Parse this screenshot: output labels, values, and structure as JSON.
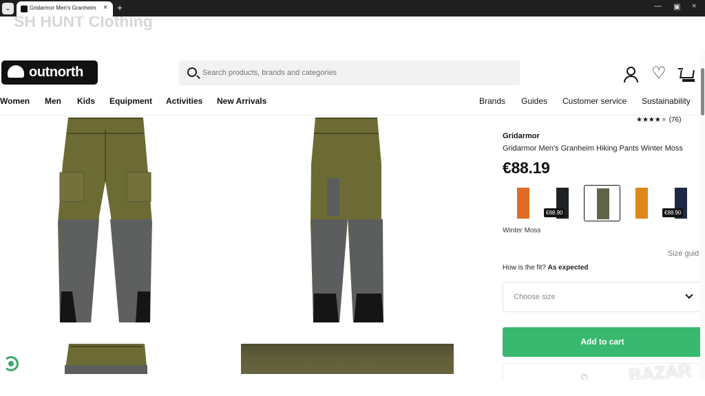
{
  "browser": {
    "tab_title": "Gridarmor Men's Granheim Hik"
  },
  "site": {
    "ghost_title": "SH HUNT Clothing",
    "logo": "outnorth",
    "search_placeholder": "Search products, brands and categories"
  },
  "nav": {
    "left": [
      "Women",
      "Men",
      "Kids",
      "Equipment",
      "Activities",
      "New Arrivals"
    ],
    "right": [
      "Brands",
      "Guides",
      "Customer service",
      "Sustainability"
    ]
  },
  "product": {
    "rating_stars": "★★★★",
    "rating_empty": "★",
    "rating_count": "(76)",
    "brand": "Gridarmor",
    "name": "Gridarmor Men's Granheim Hiking Pants Winter Moss",
    "price": "€88.19",
    "swatches": [
      {
        "color": "#e06b25",
        "price": ""
      },
      {
        "color": "#202326",
        "price": "€88.90"
      },
      {
        "color": "#5f6548",
        "price": ""
      },
      {
        "color": "#dc8718",
        "price": ""
      },
      {
        "color": "#1e2a45",
        "price": "€88.90"
      }
    ],
    "selected_color": "Winter Moss",
    "size_guide": "Size guid",
    "fit_question": "How is the fit?",
    "fit_answer": "As expected",
    "choose_size": "Choose size",
    "add_to_cart": "Add to cart"
  },
  "watermark": "BAZAR",
  "icons": [
    "search-icon",
    "account-icon",
    "heart-icon",
    "cart-icon",
    "chevron-down-icon"
  ],
  "colors": {
    "olive": "#6d6b34",
    "grey": "#5b5e5d",
    "green": "#39b86f",
    "black": "#111111"
  }
}
